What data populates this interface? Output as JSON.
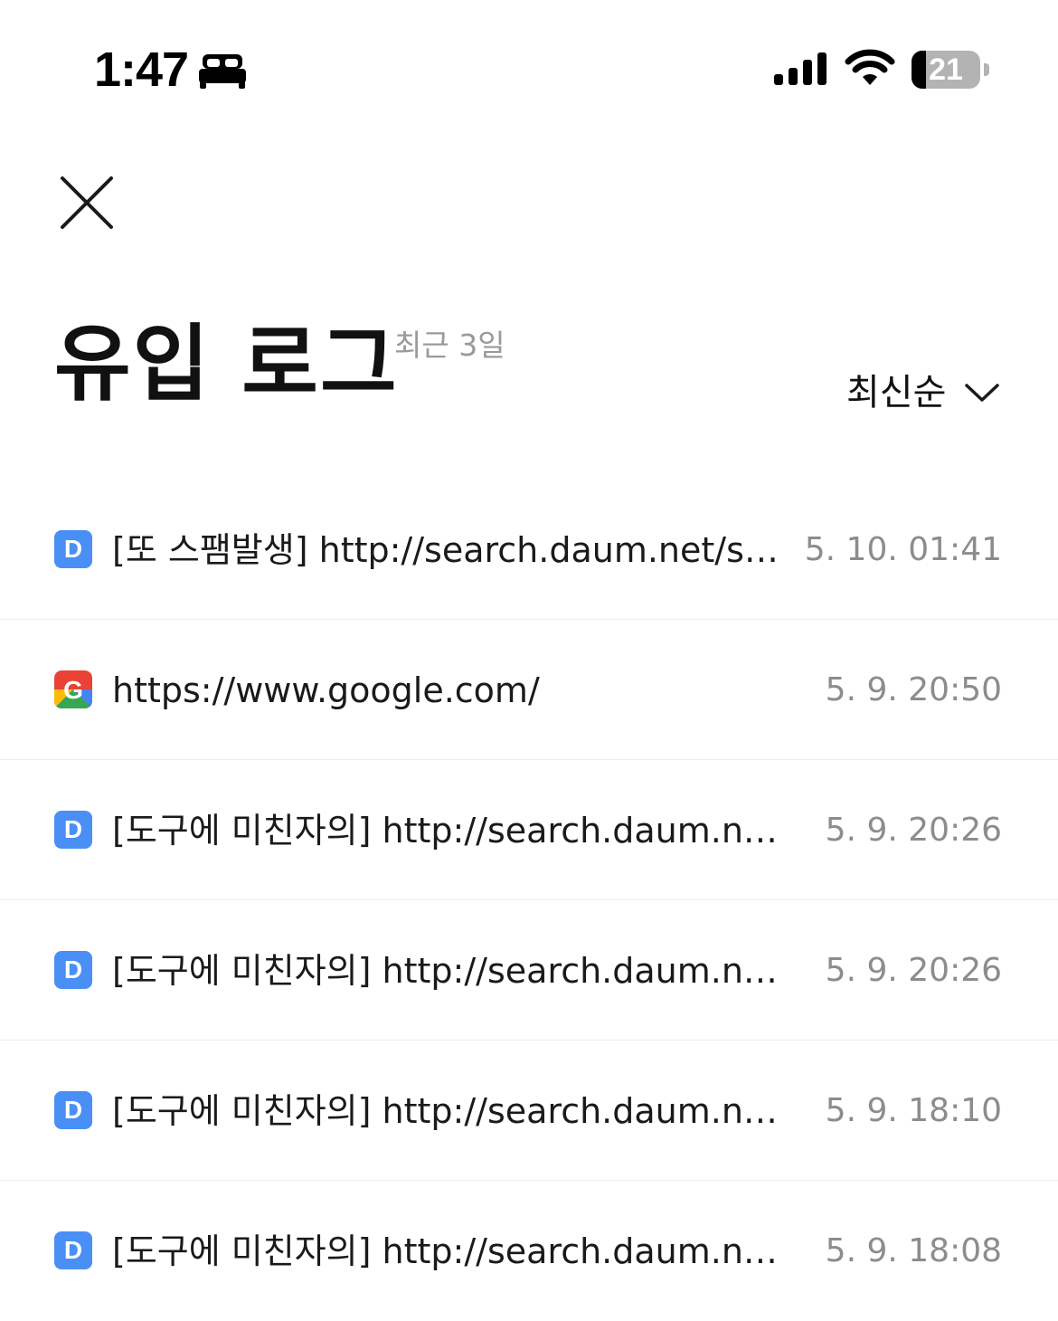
{
  "status_bar": {
    "time": "1:47",
    "focus_mode_icon": "bed-icon",
    "signal_icon": "cellular-signal-icon",
    "wifi_icon": "wifi-icon",
    "battery_level": "21",
    "battery_fraction": 0.21
  },
  "header": {
    "close_icon": "close-icon",
    "title": "유입 로그",
    "subtitle": "최근 3일",
    "sort_label": "최신순",
    "sort_icon": "chevron-down-icon"
  },
  "logs": [
    {
      "source": "daum",
      "favicon_letter": "D",
      "text": "[또 스팸발생] http://search.daum.net/search?w=tot&q=",
      "time": "5. 10. 01:41"
    },
    {
      "source": "google",
      "favicon_letter": "G",
      "text": "https://www.google.com/",
      "time": "5. 9. 20:50"
    },
    {
      "source": "daum",
      "favicon_letter": "D",
      "text": "[도구에 미친자의] http://search.daum.net/search?w=tot&q=",
      "time": "5. 9. 20:26"
    },
    {
      "source": "daum",
      "favicon_letter": "D",
      "text": "[도구에 미친자의] http://search.daum.net/search?w=tot&q=",
      "time": "5. 9. 20:26"
    },
    {
      "source": "daum",
      "favicon_letter": "D",
      "text": "[도구에 미친자의] http://search.daum.net/search?w=tot&q=",
      "time": "5. 9. 18:10"
    },
    {
      "source": "daum",
      "favicon_letter": "D",
      "text": "[도구에 미친자의] http://search.daum.net/search?w=tot&q=",
      "time": "5. 9. 18:08"
    }
  ],
  "colors": {
    "daum_favicon": "#4a8ff5",
    "timestamp": "#8c8c8c",
    "subtitle": "#9a9a9a",
    "divider": "#ececec"
  }
}
